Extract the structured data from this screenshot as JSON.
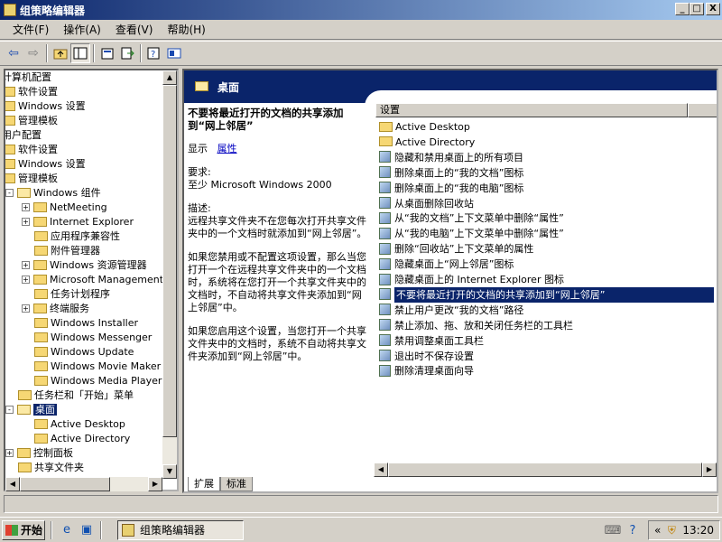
{
  "window": {
    "title": "组策略编辑器",
    "min": "_",
    "max": "□",
    "close": "X"
  },
  "menu": [
    "文件(F)",
    "操作(A)",
    "查看(V)",
    "帮助(H)"
  ],
  "tree": {
    "items": [
      {
        "label": "计算机配置",
        "indent": 0,
        "expander": "",
        "folder": false
      },
      {
        "label": "软件设置",
        "indent": 0,
        "expander": "",
        "folder": true
      },
      {
        "label": "Windows 设置",
        "indent": 0,
        "expander": "",
        "folder": true
      },
      {
        "label": "管理模板",
        "indent": 0,
        "expander": "",
        "folder": true
      },
      {
        "label": "用户配置",
        "indent": 0,
        "expander": "",
        "folder": false
      },
      {
        "label": "软件设置",
        "indent": 0,
        "expander": "",
        "folder": true
      },
      {
        "label": "Windows 设置",
        "indent": 0,
        "expander": "",
        "folder": true
      },
      {
        "label": "管理模板",
        "indent": 0,
        "expander": "",
        "folder": true
      },
      {
        "label": "Windows 组件",
        "indent": 1,
        "expander": "-",
        "folder": true
      },
      {
        "label": "NetMeeting",
        "indent": 2,
        "expander": "+",
        "folder": true
      },
      {
        "label": "Internet Explorer",
        "indent": 2,
        "expander": "+",
        "folder": true
      },
      {
        "label": "应用程序兼容性",
        "indent": 2,
        "expander": "",
        "folder": true
      },
      {
        "label": "附件管理器",
        "indent": 2,
        "expander": "",
        "folder": true
      },
      {
        "label": "Windows 资源管理器",
        "indent": 2,
        "expander": "+",
        "folder": true
      },
      {
        "label": "Microsoft Management",
        "indent": 2,
        "expander": "+",
        "folder": true
      },
      {
        "label": "任务计划程序",
        "indent": 2,
        "expander": "",
        "folder": true
      },
      {
        "label": "终端服务",
        "indent": 2,
        "expander": "+",
        "folder": true
      },
      {
        "label": "Windows Installer",
        "indent": 2,
        "expander": "",
        "folder": true
      },
      {
        "label": "Windows Messenger",
        "indent": 2,
        "expander": "",
        "folder": true
      },
      {
        "label": "Windows Update",
        "indent": 2,
        "expander": "",
        "folder": true
      },
      {
        "label": "Windows Movie Maker",
        "indent": 2,
        "expander": "",
        "folder": true
      },
      {
        "label": "Windows Media Player",
        "indent": 2,
        "expander": "",
        "folder": true
      },
      {
        "label": "任务栏和「开始」菜单",
        "indent": 1,
        "expander": "",
        "folder": true
      },
      {
        "label": "桌面",
        "indent": 1,
        "expander": "-",
        "folder": true,
        "selected": true
      },
      {
        "label": "Active Desktop",
        "indent": 2,
        "expander": "",
        "folder": true
      },
      {
        "label": "Active Directory",
        "indent": 2,
        "expander": "",
        "folder": true
      },
      {
        "label": "控制面板",
        "indent": 1,
        "expander": "+",
        "folder": true
      },
      {
        "label": "共享文件夹",
        "indent": 1,
        "expander": "",
        "folder": true
      }
    ]
  },
  "header": {
    "title": "桌面"
  },
  "description": {
    "title": "不要将最近打开的文档的共享添加到“网上邻居”",
    "show_label": "显示",
    "properties_link": "属性",
    "requirements_label": "要求:",
    "requirements_text": "至少 Microsoft Windows 2000",
    "desc_label": "描述:",
    "desc_text": "远程共享文件夹不在您每次打开共享文件夹中的一个文档时就添加到“网上邻居”。",
    "disabled_text": "如果您禁用或不配置这项设置，那么当您打开一个在远程共享文件夹中的一个文档时，系统将在您打开一个共享文件夹中的文档时，不自动将共享文件夹添加到“网上邻居”中。",
    "enabled_text": "如果您启用这个设置，当您打开一个共享文件夹中的文档时，系统不自动将共享文件夹添加到“网上邻居”中。"
  },
  "list": {
    "column": "设置",
    "items": [
      {
        "label": "Active Desktop",
        "type": "folder"
      },
      {
        "label": "Active Directory",
        "type": "folder"
      },
      {
        "label": "隐藏和禁用桌面上的所有项目",
        "type": "setting"
      },
      {
        "label": "删除桌面上的“我的文档”图标",
        "type": "setting"
      },
      {
        "label": "删除桌面上的“我的电脑”图标",
        "type": "setting"
      },
      {
        "label": "从桌面删除回收站",
        "type": "setting"
      },
      {
        "label": "从“我的文档”上下文菜单中删除“属性”",
        "type": "setting"
      },
      {
        "label": "从“我的电脑”上下文菜单中删除“属性”",
        "type": "setting"
      },
      {
        "label": "删除“回收站”上下文菜单的属性",
        "type": "setting"
      },
      {
        "label": "隐藏桌面上“网上邻居”图标",
        "type": "setting"
      },
      {
        "label": "隐藏桌面上的 Internet Explorer 图标",
        "type": "setting"
      },
      {
        "label": "不要将最近打开的文档的共享添加到“网上邻居”",
        "type": "setting",
        "selected": true
      },
      {
        "label": "禁止用户更改“我的文档”路径",
        "type": "setting"
      },
      {
        "label": "禁止添加、拖、放和关闭任务栏的工具栏",
        "type": "setting"
      },
      {
        "label": "禁用调整桌面工具栏",
        "type": "setting"
      },
      {
        "label": "退出时不保存设置",
        "type": "setting"
      },
      {
        "label": "删除清理桌面向导",
        "type": "setting"
      }
    ]
  },
  "tabs": [
    "扩展",
    "标准"
  ],
  "taskbar": {
    "start_label": "开始",
    "task_label": "组策略编辑器",
    "clock": "13:20"
  }
}
